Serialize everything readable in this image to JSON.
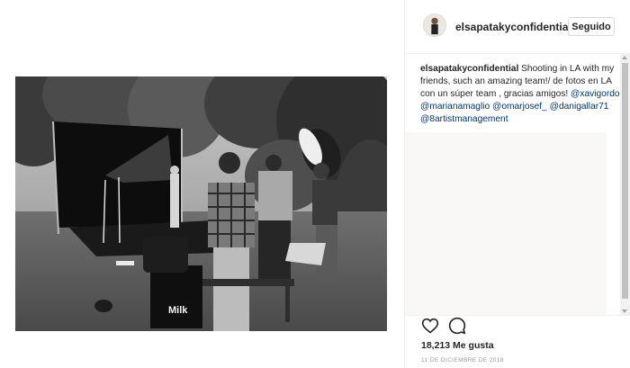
{
  "post": {
    "username": "elsapatakyconfidential",
    "follow_label": "Seguido",
    "caption_user": "elsapatakyconfidential",
    "caption_text": " Shooting in LA with my friends, such an amazing team!/ de fotos en LA con un súper team , gracias amigos! ",
    "mentions": [
      "@xavigordo",
      "@marianamaglio",
      "@omarjosef_",
      "@danigallar71",
      "@8artistmanagement"
    ],
    "likes": "18,213 Me gusta",
    "date": "11 DE DICIEMBRE DE 2018"
  },
  "photo": {
    "bag_brand": "Milk"
  },
  "icons": {
    "like": "heart-icon",
    "comment": "comment-icon"
  },
  "colors": {
    "text": "#262626",
    "mention": "#003569",
    "muted": "#999999",
    "border": "#dbdbdb"
  }
}
